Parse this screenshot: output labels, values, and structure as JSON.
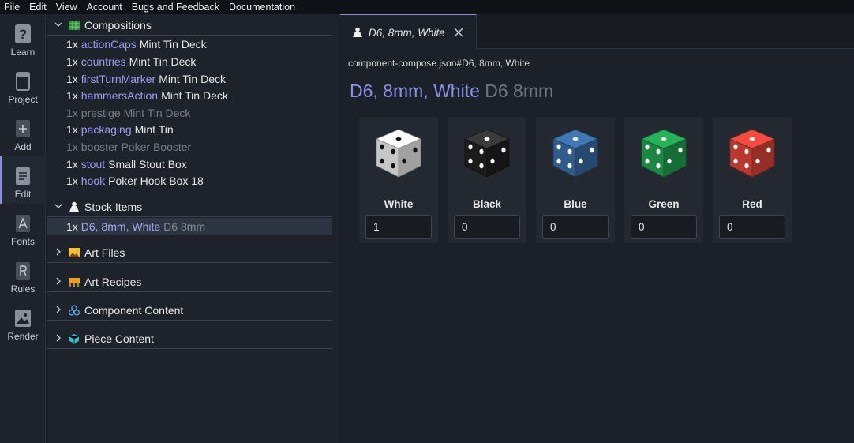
{
  "menu": [
    "File",
    "Edit",
    "View",
    "Account",
    "Bugs and Feedback",
    "Documentation"
  ],
  "rail": [
    {
      "label": "Learn",
      "icon": "question-icon"
    },
    {
      "label": "Project",
      "icon": "box-icon"
    },
    {
      "label": "Add",
      "icon": "plus-icon"
    },
    {
      "label": "Edit",
      "icon": "document-icon",
      "active": true
    },
    {
      "label": "Fonts",
      "icon": "font-icon"
    },
    {
      "label": "Rules",
      "icon": "rules-icon"
    },
    {
      "label": "Render",
      "icon": "image-icon"
    }
  ],
  "tree": {
    "compositions": {
      "title": "Compositions",
      "items": [
        {
          "qty": "1x",
          "name": "actionCaps",
          "type": "Mint Tin Deck"
        },
        {
          "qty": "1x",
          "name": "countries",
          "type": "Mint Tin Deck"
        },
        {
          "qty": "1x",
          "name": "firstTurnMarker",
          "type": "Mint Tin Deck"
        },
        {
          "qty": "1x",
          "name": "hammersAction",
          "type": "Mint Tin Deck"
        },
        {
          "qty": "1x",
          "name": "prestige",
          "type": "Mint Tin Deck",
          "dim": true
        },
        {
          "qty": "1x",
          "name": "packaging",
          "type": "Mint Tin"
        },
        {
          "qty": "1x",
          "name": "booster",
          "type": "Poker Booster",
          "dim": true
        },
        {
          "qty": "1x",
          "name": "stout",
          "type": "Small Stout Box"
        },
        {
          "qty": "1x",
          "name": "hook",
          "type": "Poker Hook Box 18"
        }
      ]
    },
    "stock_items": {
      "title": "Stock Items",
      "items": [
        {
          "qty": "1x",
          "name": "D6, 8mm, White",
          "type": "D6 8mm",
          "selected": true
        }
      ]
    },
    "art_files": "Art Files",
    "art_recipes": "Art Recipes",
    "component_content": "Component Content",
    "piece_content": "Piece Content"
  },
  "tab": {
    "label": "D6, 8mm, White"
  },
  "editor": {
    "path": "component-compose.json#D6, 8mm, White",
    "title_name": "D6, 8mm, White",
    "title_type": "D6 8mm",
    "dice": [
      {
        "label": "White",
        "value": "1",
        "color": "#f2f2f2",
        "pip": "#111111"
      },
      {
        "label": "Black",
        "value": "0",
        "color": "#1e1e1e",
        "pip": "#f5f5f5"
      },
      {
        "label": "Blue",
        "value": "0",
        "color": "#3a6fa8",
        "pip": "#f5f5f5"
      },
      {
        "label": "Green",
        "value": "0",
        "color": "#22a552",
        "pip": "#f5f5f5"
      },
      {
        "label": "Red",
        "value": "0",
        "color": "#e2463a",
        "pip": "#f5f5f5"
      }
    ]
  }
}
